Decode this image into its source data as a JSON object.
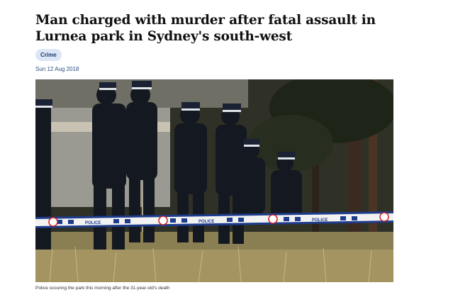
{
  "article": {
    "headline": "Man charged with murder after fatal assault in Lurnea park in Sydney's south-west",
    "category": "Crime",
    "date": "Sun 12 Aug 2018",
    "image": {
      "description_icon": "news-photo",
      "tape_text": "POLICE"
    },
    "caption": "Police scouring the park this morning after the 31-year-old's death"
  }
}
